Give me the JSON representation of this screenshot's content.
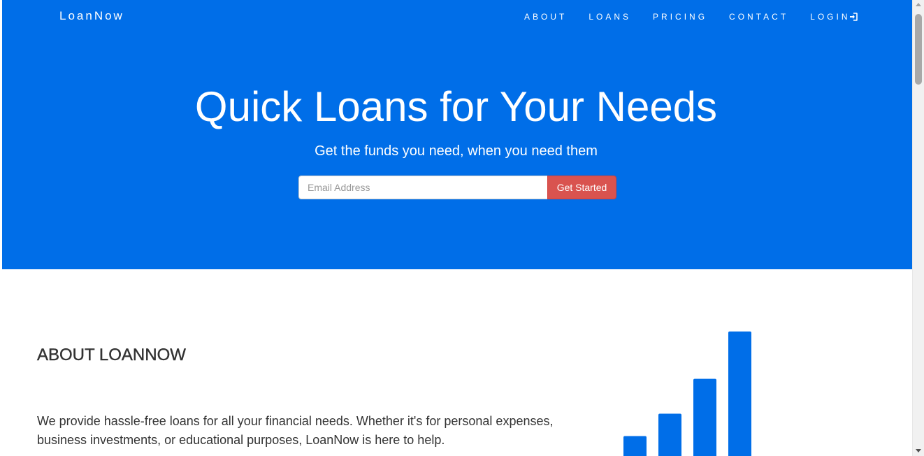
{
  "header": {
    "brand": "LoanNow",
    "nav": [
      {
        "label": "ABOUT"
      },
      {
        "label": "LOANS"
      },
      {
        "label": "PRICING"
      },
      {
        "label": "CONTACT"
      },
      {
        "label": "LOGIN",
        "icon": "log-in-icon"
      }
    ]
  },
  "hero": {
    "title": "Quick Loans for Your Needs",
    "subtitle": "Get the funds you need, when you need them",
    "email_placeholder": "Email Address",
    "cta_label": "Get Started"
  },
  "about": {
    "heading": "ABOUT LOANNOW",
    "text": "We provide hassle-free loans for all your financial needs. Whether it's for personal expenses, business investments, or educational purposes, LoanNow is here to help."
  },
  "growth_graphic": {
    "icon": "bar-chart-icon",
    "relative_heights": [
      0.16,
      0.34,
      0.62,
      1.0
    ]
  },
  "colors": {
    "primary": "#006ee8",
    "cta": "#d9534f",
    "text": "#333333",
    "on_primary": "#ffffff"
  }
}
